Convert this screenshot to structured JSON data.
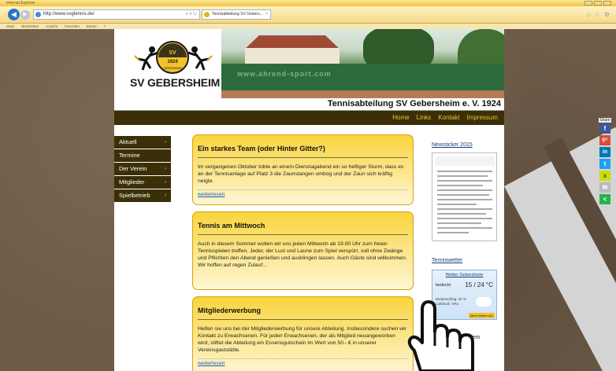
{
  "browser": {
    "window_title": "Internet Explorer",
    "url": "http://www.svgtennis.de/",
    "tab_title": "Tennisabteilung SV Gebers...",
    "menu": [
      "Datei",
      "Bearbeiten",
      "Ansicht",
      "Favoriten",
      "Extras",
      "?"
    ]
  },
  "site": {
    "logo_text": "SV GEBERSHEIM",
    "emblem_year": "1924",
    "emblem_name": "GEBERSHEIM",
    "photo_banner": "www.ahrend-sport.com",
    "title": "Tennisabteilung SV Gebersheim e. V. 1924",
    "topnav": [
      "Home",
      "Links",
      "Kontakt",
      "Impressum"
    ],
    "sidemenu": [
      "Aktuell",
      "Termine",
      "Der Verein",
      "Mitglieder",
      "Spielbetrieb"
    ],
    "sidemenu_chevron": [
      "›",
      "",
      "›",
      "›",
      "›"
    ]
  },
  "articles": [
    {
      "title": "Ein starkes Team (oder Hinter Gitter?)",
      "text": "Im vergangenen Oktober tobte an einem Dienstagabend ein so heftiger Sturm, dass es an der Tennisanlage auf Platz 3 die Zaunstangen umbog und der Zaun sich kräftig neigte.",
      "more": "weiterlesen"
    },
    {
      "title": "Tennis am Mittwoch",
      "text": "Auch in diesem Sommer wollen wir uns jeden Mittwoch ab 19.00 Uhr zum freien Tennisspielen treffen. Jeder, der Lust und Laune zum Spiel verspürt, soll ohne Zwänge und Pflichten den Abend genießen und ausklingen lassen. Auch Gäste sind willkommen. Wir hoffen auf regen Zulauf...",
      "more": ""
    },
    {
      "title": "Mitgliederwerbung",
      "text": "Helfen sie uns bei der Mitgliederwerbung für unsere Abteilung. Insbesondere suchen wir Kontakt zu Erwachsenen. Für jeden Erwachsenen, der als Mitglied neuangeworben wird, stiftet die Abteilung ein Essensgutschein im Wert von 50.- € in unserer Vereinsgaststätte.",
      "more": "weiterlesen"
    }
  ],
  "right": {
    "newsticker": "Newsticker 2015",
    "tenniswetter": "Tenniswetter",
    "weather_title": "Wetter Gebersheim",
    "weather_cond": "bedeckt",
    "weather_temp": "15 / 24 °C",
    "weather_detail": "Niederschlag: 30 % Luftdruck: hPa",
    "weather_link": "Mehr Wetter auf",
    "partial_text": "t dem"
  },
  "share": {
    "label": "Share",
    "icons": [
      {
        "name": "facebook-icon",
        "glyph": "f",
        "color": "#3b5998"
      },
      {
        "name": "googleplus-icon",
        "glyph": "g+",
        "color": "#dd4b39"
      },
      {
        "name": "linkedin-icon",
        "glyph": "in",
        "color": "#0077b5"
      },
      {
        "name": "twitter-icon",
        "glyph": "t",
        "color": "#1da1f2"
      },
      {
        "name": "xing-icon",
        "glyph": "x",
        "color": "#cfdc00"
      },
      {
        "name": "mail-icon",
        "glyph": "✉",
        "color": "#bbbbbb"
      },
      {
        "name": "share-icon",
        "glyph": "<",
        "color": "#2bb24c"
      }
    ]
  }
}
